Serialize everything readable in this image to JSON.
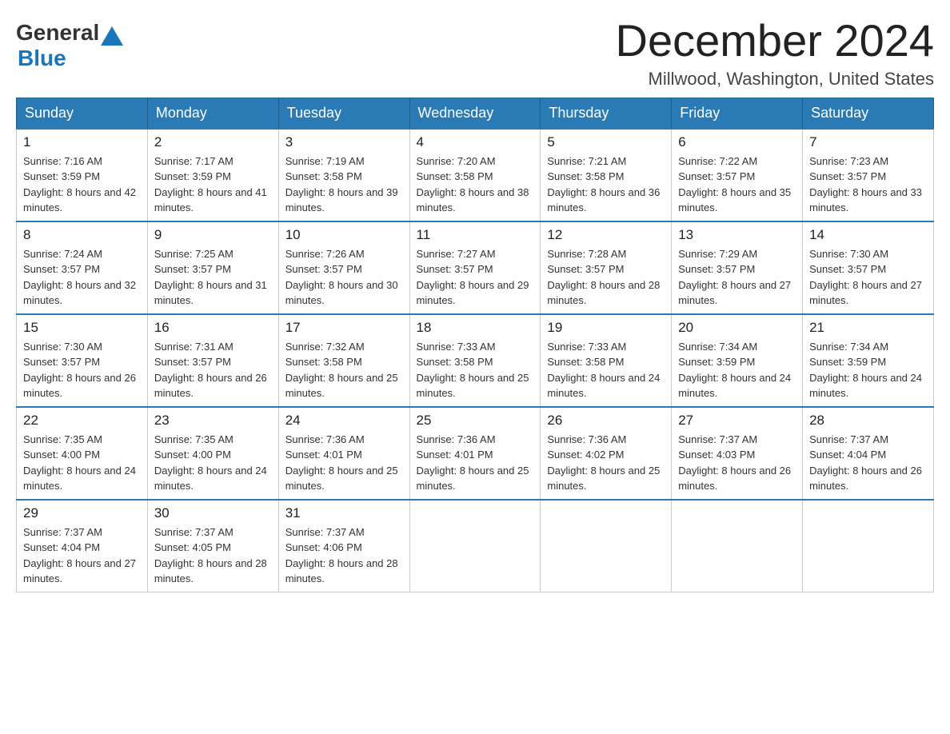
{
  "header": {
    "logo_general": "General",
    "logo_blue": "Blue",
    "month_title": "December 2024",
    "location": "Millwood, Washington, United States"
  },
  "days_of_week": [
    "Sunday",
    "Monday",
    "Tuesday",
    "Wednesday",
    "Thursday",
    "Friday",
    "Saturday"
  ],
  "weeks": [
    [
      {
        "day": "1",
        "sunrise": "7:16 AM",
        "sunset": "3:59 PM",
        "daylight": "8 hours and 42 minutes."
      },
      {
        "day": "2",
        "sunrise": "7:17 AM",
        "sunset": "3:59 PM",
        "daylight": "8 hours and 41 minutes."
      },
      {
        "day": "3",
        "sunrise": "7:19 AM",
        "sunset": "3:58 PM",
        "daylight": "8 hours and 39 minutes."
      },
      {
        "day": "4",
        "sunrise": "7:20 AM",
        "sunset": "3:58 PM",
        "daylight": "8 hours and 38 minutes."
      },
      {
        "day": "5",
        "sunrise": "7:21 AM",
        "sunset": "3:58 PM",
        "daylight": "8 hours and 36 minutes."
      },
      {
        "day": "6",
        "sunrise": "7:22 AM",
        "sunset": "3:57 PM",
        "daylight": "8 hours and 35 minutes."
      },
      {
        "day": "7",
        "sunrise": "7:23 AM",
        "sunset": "3:57 PM",
        "daylight": "8 hours and 33 minutes."
      }
    ],
    [
      {
        "day": "8",
        "sunrise": "7:24 AM",
        "sunset": "3:57 PM",
        "daylight": "8 hours and 32 minutes."
      },
      {
        "day": "9",
        "sunrise": "7:25 AM",
        "sunset": "3:57 PM",
        "daylight": "8 hours and 31 minutes."
      },
      {
        "day": "10",
        "sunrise": "7:26 AM",
        "sunset": "3:57 PM",
        "daylight": "8 hours and 30 minutes."
      },
      {
        "day": "11",
        "sunrise": "7:27 AM",
        "sunset": "3:57 PM",
        "daylight": "8 hours and 29 minutes."
      },
      {
        "day": "12",
        "sunrise": "7:28 AM",
        "sunset": "3:57 PM",
        "daylight": "8 hours and 28 minutes."
      },
      {
        "day": "13",
        "sunrise": "7:29 AM",
        "sunset": "3:57 PM",
        "daylight": "8 hours and 27 minutes."
      },
      {
        "day": "14",
        "sunrise": "7:30 AM",
        "sunset": "3:57 PM",
        "daylight": "8 hours and 27 minutes."
      }
    ],
    [
      {
        "day": "15",
        "sunrise": "7:30 AM",
        "sunset": "3:57 PM",
        "daylight": "8 hours and 26 minutes."
      },
      {
        "day": "16",
        "sunrise": "7:31 AM",
        "sunset": "3:57 PM",
        "daylight": "8 hours and 26 minutes."
      },
      {
        "day": "17",
        "sunrise": "7:32 AM",
        "sunset": "3:58 PM",
        "daylight": "8 hours and 25 minutes."
      },
      {
        "day": "18",
        "sunrise": "7:33 AM",
        "sunset": "3:58 PM",
        "daylight": "8 hours and 25 minutes."
      },
      {
        "day": "19",
        "sunrise": "7:33 AM",
        "sunset": "3:58 PM",
        "daylight": "8 hours and 24 minutes."
      },
      {
        "day": "20",
        "sunrise": "7:34 AM",
        "sunset": "3:59 PM",
        "daylight": "8 hours and 24 minutes."
      },
      {
        "day": "21",
        "sunrise": "7:34 AM",
        "sunset": "3:59 PM",
        "daylight": "8 hours and 24 minutes."
      }
    ],
    [
      {
        "day": "22",
        "sunrise": "7:35 AM",
        "sunset": "4:00 PM",
        "daylight": "8 hours and 24 minutes."
      },
      {
        "day": "23",
        "sunrise": "7:35 AM",
        "sunset": "4:00 PM",
        "daylight": "8 hours and 24 minutes."
      },
      {
        "day": "24",
        "sunrise": "7:36 AM",
        "sunset": "4:01 PM",
        "daylight": "8 hours and 25 minutes."
      },
      {
        "day": "25",
        "sunrise": "7:36 AM",
        "sunset": "4:01 PM",
        "daylight": "8 hours and 25 minutes."
      },
      {
        "day": "26",
        "sunrise": "7:36 AM",
        "sunset": "4:02 PM",
        "daylight": "8 hours and 25 minutes."
      },
      {
        "day": "27",
        "sunrise": "7:37 AM",
        "sunset": "4:03 PM",
        "daylight": "8 hours and 26 minutes."
      },
      {
        "day": "28",
        "sunrise": "7:37 AM",
        "sunset": "4:04 PM",
        "daylight": "8 hours and 26 minutes."
      }
    ],
    [
      {
        "day": "29",
        "sunrise": "7:37 AM",
        "sunset": "4:04 PM",
        "daylight": "8 hours and 27 minutes."
      },
      {
        "day": "30",
        "sunrise": "7:37 AM",
        "sunset": "4:05 PM",
        "daylight": "8 hours and 28 minutes."
      },
      {
        "day": "31",
        "sunrise": "7:37 AM",
        "sunset": "4:06 PM",
        "daylight": "8 hours and 28 minutes."
      },
      null,
      null,
      null,
      null
    ]
  ],
  "labels": {
    "sunrise": "Sunrise:",
    "sunset": "Sunset:",
    "daylight": "Daylight:"
  }
}
